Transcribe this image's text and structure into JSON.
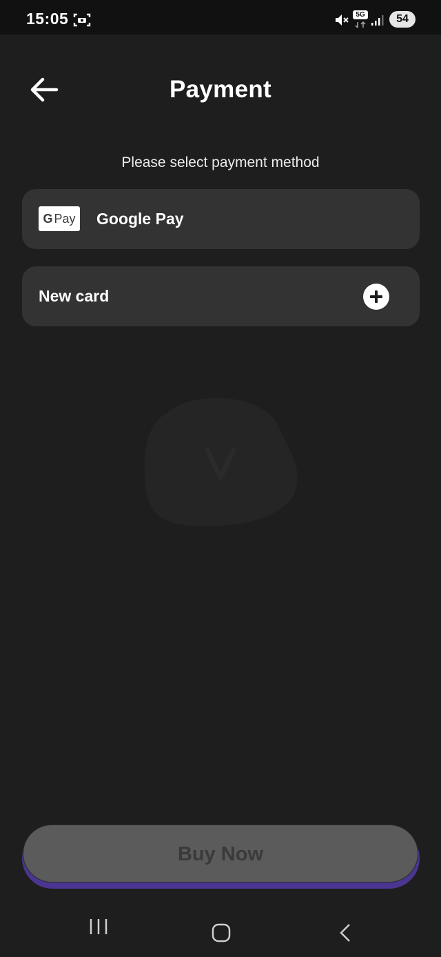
{
  "status_bar": {
    "time": "15:05",
    "battery": "54",
    "network": "5G",
    "icons": [
      "screenshot-icon",
      "mute-icon",
      "5g-icon",
      "signal-icon",
      "battery-icon"
    ]
  },
  "header": {
    "title": "Payment",
    "back_icon": "arrow-left-icon"
  },
  "main": {
    "subtitle": "Please select payment method",
    "methods": [
      {
        "label": "Google Pay",
        "logo_g": "G",
        "logo_pay": "Pay",
        "icon": "google-pay-logo"
      },
      {
        "label": "New card",
        "icon": "plus-icon"
      }
    ]
  },
  "footer": {
    "buy_label": "Buy Now"
  },
  "nav_bar": {
    "items": [
      "recents-icon",
      "home-icon",
      "back-icon"
    ]
  },
  "colors": {
    "background": "#1e1e1e",
    "card": "#333333",
    "button_disabled": "#5b5b5b",
    "accent": "#4a3590"
  }
}
